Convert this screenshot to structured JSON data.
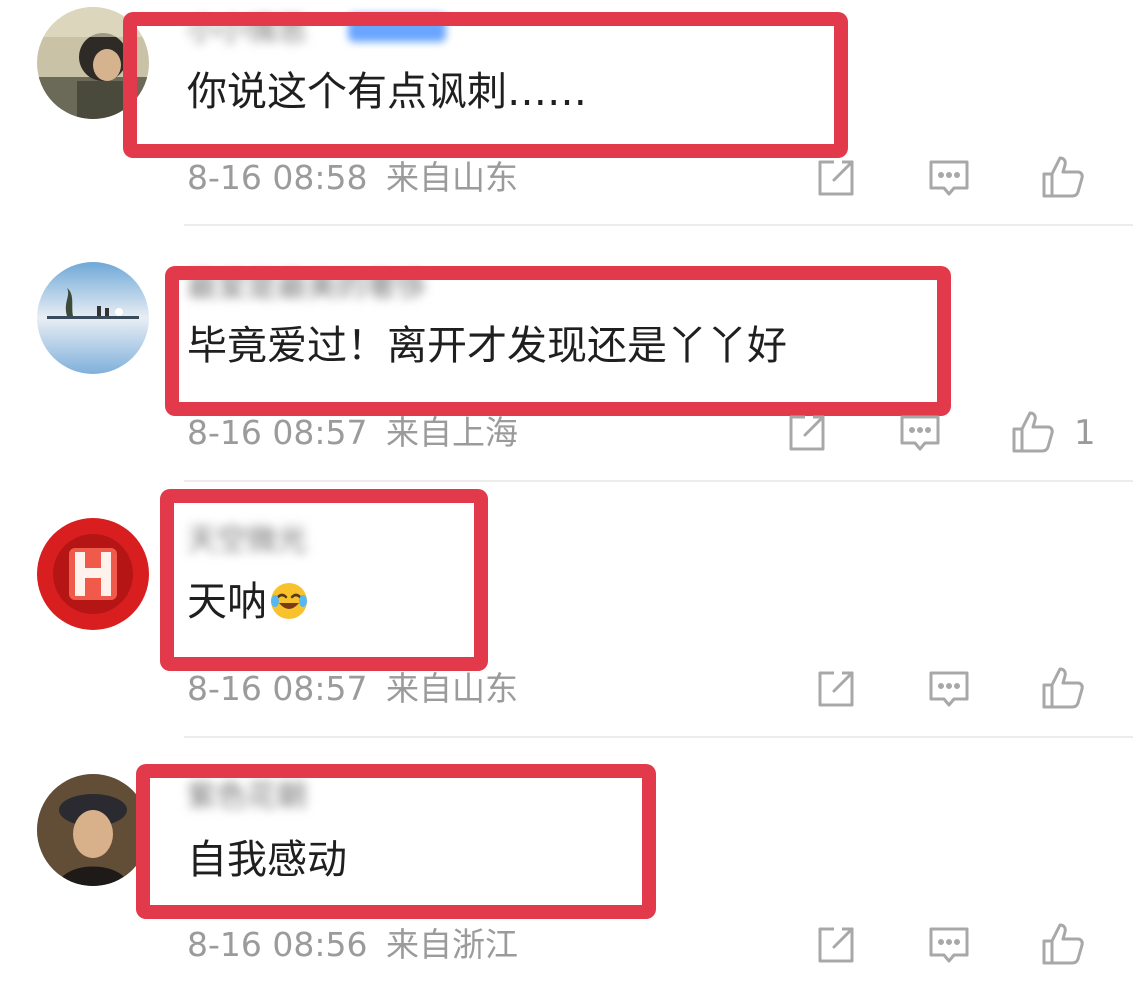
{
  "comments": [
    {
      "username": "小小情思",
      "has_vip": true,
      "text": "你说这个有点讽刺……",
      "time": "8-16 08:58",
      "location": "来自山东",
      "likes": ""
    },
    {
      "username": "最爱是最美的奢侈",
      "has_vip": false,
      "text": "毕竟爱过！离开才发现还是丫丫好",
      "time": "8-16 08:57",
      "location": "来自上海",
      "likes": "1"
    },
    {
      "username": "天空微光",
      "has_vip": false,
      "text": "天呐",
      "emoji": "laughing-crying-emoji",
      "time": "8-16 08:57",
      "location": "来自山东",
      "likes": ""
    },
    {
      "username": "紫色花朝",
      "has_vip": false,
      "text": "自我感动",
      "time": "8-16 08:56",
      "location": "来自浙江",
      "likes": ""
    }
  ],
  "icons": {
    "repost": "repost-icon",
    "reply": "reply-icon",
    "like": "like-icon"
  },
  "colors": {
    "highlight": "#e33a4b",
    "meta_text": "#9b9b9b",
    "icon": "#a8a8a8"
  }
}
